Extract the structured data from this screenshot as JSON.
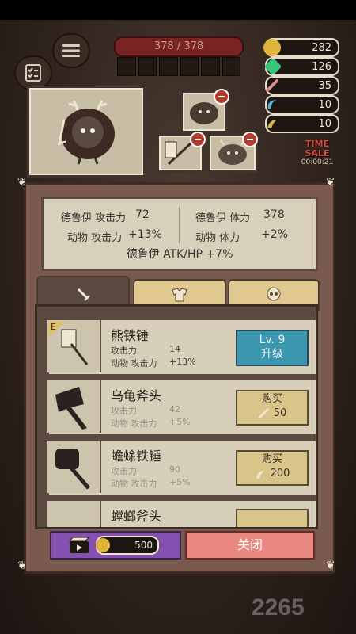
{
  "hud": {
    "hp_text": "378 / 378",
    "timer_label": "TIME SALE",
    "timer_value": "00:00:21"
  },
  "resources": [
    {
      "icon": "gold-coin-icon",
      "value": "282",
      "color": "#e0b43a"
    },
    {
      "icon": "green-gem-icon",
      "value": "126",
      "color": "#38c47a"
    },
    {
      "icon": "bone-icon",
      "value": "35",
      "color": "#d98a8a"
    },
    {
      "icon": "claw-icon",
      "value": "10",
      "color": "#5ab4c8"
    },
    {
      "icon": "horn-icon",
      "value": "10",
      "color": "#d8b24a"
    }
  ],
  "stats": {
    "druid_atk_label": "德鲁伊 攻击力",
    "druid_atk_value": "72",
    "druid_hp_label": "德鲁伊 体力",
    "druid_hp_value": "378",
    "animal_atk_label": "动物 攻击力",
    "animal_atk_value": "+13%",
    "animal_hp_label": "动物 体力",
    "animal_hp_value": "+2%",
    "bonus": "德鲁伊 ATK/HP +7%"
  },
  "tabs": [
    {
      "name": "weapon",
      "icon": "sword-icon",
      "active": true
    },
    {
      "name": "armor",
      "icon": "armor-icon",
      "active": false
    },
    {
      "name": "accessory",
      "icon": "skull-icon",
      "active": false
    }
  ],
  "items": [
    {
      "name": "熊铁锤",
      "badge": "E",
      "atk_label": "攻击力",
      "atk_value": "14",
      "animal_label": "动物 攻击力",
      "animal_value": "+13%",
      "action": "upgrade",
      "level": "Lv. 9",
      "action_label": "升级"
    },
    {
      "name": "乌龟斧头",
      "atk_label": "攻击力",
      "atk_value": "42",
      "animal_label": "动物 攻击力",
      "animal_value": "+5%",
      "action": "buy",
      "action_label": "购买",
      "price": "50",
      "price_icon": "bone-icon"
    },
    {
      "name": "蟾蜍铁锤",
      "atk_label": "攻击力",
      "atk_value": "90",
      "animal_label": "动物 攻击力",
      "animal_value": "+5%",
      "action": "buy",
      "action_label": "购买",
      "price": "200",
      "price_icon": "horn-icon"
    },
    {
      "name": "螳螂斧头"
    }
  ],
  "bottom": {
    "video_cost": "500",
    "close_label": "关闭"
  },
  "watermark": "2265"
}
